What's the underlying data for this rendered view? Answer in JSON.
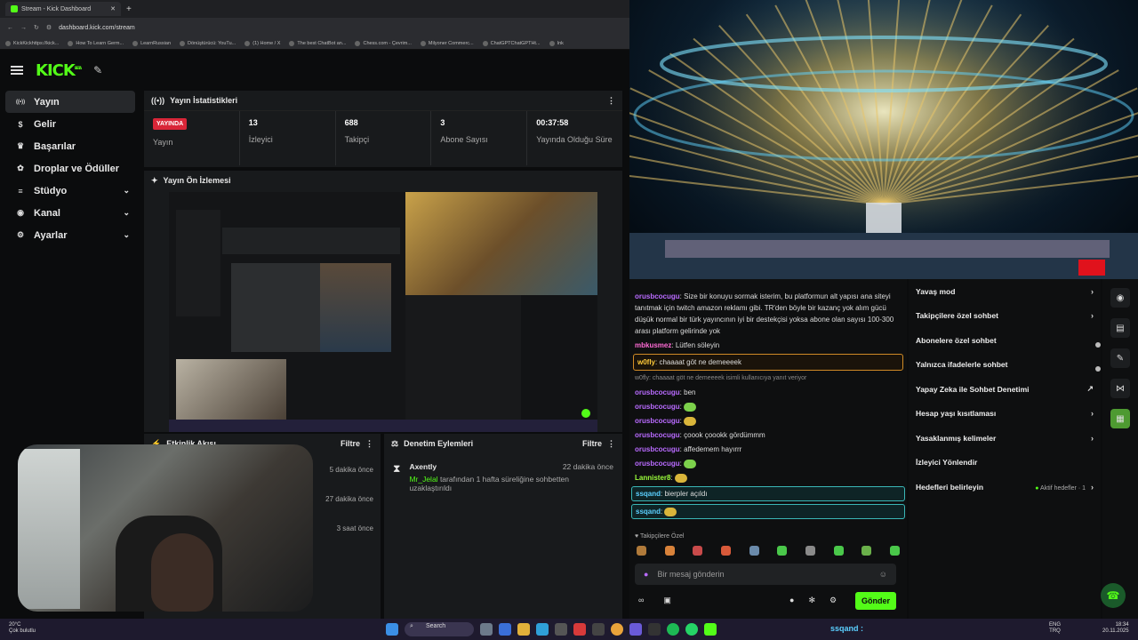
{
  "browser": {
    "tab_title": "Stream - Kick Dashboard",
    "new_tab": "+",
    "url": "dashboard.kick.com/stream",
    "bookmarks": [
      "KickKickhttps://kick...",
      "How To Learn Germ...",
      "LearnRussian",
      "Dönüştürücü: YouTu...",
      "(1) Home / X",
      "The best ChatBot an...",
      "Chess.com - Çevrim...",
      "Milyoner Commerc...",
      "ChatGPTChatGPTHt...",
      "Ink"
    ]
  },
  "kick": {
    "logo": "KICK",
    "logo_beta": "BETA",
    "sidebar": [
      {
        "label": "Yayın",
        "icon": "broadcast-icon",
        "active": true
      },
      {
        "label": "Gelir",
        "icon": "dollar-icon"
      },
      {
        "label": "Başarılar",
        "icon": "trophy-icon"
      },
      {
        "label": "Droplar ve Ödüller",
        "icon": "gift-icon"
      },
      {
        "label": "Stüdyo",
        "icon": "sliders-icon",
        "expand": true
      },
      {
        "label": "Kanal",
        "icon": "users-icon",
        "expand": true
      },
      {
        "label": "Ayarlar",
        "icon": "gear-icon",
        "expand": true
      }
    ],
    "stats": {
      "title": "Yayın İstatistikleri",
      "live_badge": "YAYINDA",
      "live_label": "Yayın",
      "items": [
        {
          "value": "13",
          "label": "İzleyici"
        },
        {
          "value": "688",
          "label": "Takipçi"
        },
        {
          "value": "3",
          "label": "Abone Sayısı"
        },
        {
          "value": "00:37:58",
          "label": "Yayında Olduğu Süre"
        }
      ]
    },
    "preview_title": "Yayın Ön İzlemesi",
    "events": {
      "title": "Etkinlik Akışı",
      "filter": "Filtre",
      "times": [
        "5 dakika önce",
        "27 dakika önce",
        "3 saat önce"
      ]
    },
    "moderation": {
      "title": "Denetim Eylemleri",
      "filter": "Filtre",
      "entries": [
        {
          "user": "Axently",
          "time": "22 dakika önce",
          "target": "Mr_Jelal",
          "text": "tarafından 1 hafta süreliğine sohbetten uzaklaştırıldı"
        }
      ]
    }
  },
  "chat": {
    "messages": [
      {
        "user": "orusbcocugu",
        "cls": "u1",
        "text": "Size bir konuyu sormak isterim, bu platformun alt yapısı ana siteyi tanıtmak için twitch amazon reklamı gibi. TR'den böyle bir kazanç yok alım gücü düşük normal bir türk yayıncının iyi bir destekçisi yoksa abone olan sayısı 100-300 arası platform gelirinde yok"
      },
      {
        "user": "mbkusmez",
        "cls": "u2",
        "text": "Lütfen söleyin"
      },
      {
        "user": "w0fly",
        "cls": "u5",
        "text": "chaaaat göt ne demeeeek",
        "highlight": true
      },
      {
        "reply": "w0fly: chaaaat göt ne demeeeek isimli kullanıcıya yanıt veriyor"
      },
      {
        "user": "orusbcocugu",
        "cls": "u1",
        "text": "ben"
      },
      {
        "user": "orusbcocugu",
        "cls": "u1",
        "text": "",
        "emote": true
      },
      {
        "user": "orusbcocugu",
        "cls": "u1",
        "text": "",
        "emote": true
      },
      {
        "user": "orusbcocugu",
        "cls": "u1",
        "text": "çoook çoookk gördümmm"
      },
      {
        "user": "orusbcocugu",
        "cls": "u1",
        "text": "affedemem hayırrr"
      },
      {
        "user": "orusbcocugu",
        "cls": "u1",
        "text": "",
        "emote": true
      },
      {
        "user": "Lannister8",
        "cls": "u3",
        "text": "",
        "emote": true
      },
      {
        "user": "ssqand",
        "cls": "u4",
        "text": "bierpler açıldı",
        "boxed": true
      },
      {
        "user": "ssqand",
        "cls": "u4",
        "text": "",
        "emote": true,
        "boxed": true
      }
    ],
    "followers_only": "Takipçilere Özel",
    "input_placeholder": "Bir mesaj gönderin",
    "send": "Gönder",
    "infinity": "∞"
  },
  "settings": [
    {
      "label": "Yavaş mod",
      "right": "chevron"
    },
    {
      "label": "Takipçilere özel sohbet",
      "right": "chevron"
    },
    {
      "label": "Abonelere özel sohbet",
      "right": "toggle"
    },
    {
      "label": "Yalnızca ifadelerle sohbet",
      "right": "toggle"
    },
    {
      "label": "Yapay Zeka ile Sohbet Denetimi",
      "right": "external"
    },
    {
      "label": "Hesap yaşı kısıtlaması",
      "right": "chevron"
    },
    {
      "label": "Yasaklanmış kelimeler",
      "right": "chevron"
    },
    {
      "label": "İzleyici Yönlendir",
      "right": ""
    },
    {
      "label": "Hedefleri belirleyin",
      "right": "chevron",
      "sub": "Aktif hedefler · 1"
    }
  ],
  "taskbar": {
    "weather_temp": "20°C",
    "weather_desc": "Çok bulutlu",
    "search": "Search",
    "ticker": "ssqand :",
    "lang": "ENG",
    "lang2": "TRQ",
    "time": "18:34",
    "date": "20.11.2025"
  },
  "colors": {
    "accent": "#53fc18",
    "live": "#d92638",
    "bg": "#0b0c0d",
    "panel": "#181a1c"
  }
}
